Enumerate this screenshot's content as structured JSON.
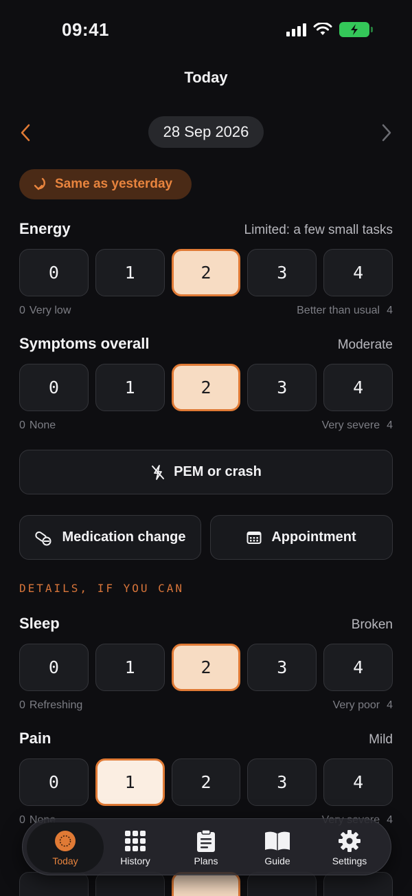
{
  "status": {
    "time": "09:41"
  },
  "header": {
    "title": "Today"
  },
  "date": {
    "label": "28 Sep 2026"
  },
  "same_as_yesterday": "Same as yesterday",
  "colors": {
    "accent": "#e07a35",
    "selected_fill": "#f7dcc3",
    "background": "#0e0e11"
  },
  "scales": [
    {
      "title": "Energy",
      "value": "Limited: a few small tasks",
      "options": [
        "0",
        "1",
        "2",
        "3",
        "4"
      ],
      "selected": "2",
      "low_num": "0",
      "low_label": "Very low",
      "high_label": "Better than usual",
      "high_num": "4"
    },
    {
      "title": "Symptoms overall",
      "value": "Moderate",
      "options": [
        "0",
        "1",
        "2",
        "3",
        "4"
      ],
      "selected": "2",
      "low_num": "0",
      "low_label": "None",
      "high_label": "Very severe",
      "high_num": "4"
    },
    {
      "title": "Sleep",
      "value": "Broken",
      "options": [
        "0",
        "1",
        "2",
        "3",
        "4"
      ],
      "selected": "2",
      "low_num": "0",
      "low_label": "Refreshing",
      "high_label": "Very poor",
      "high_num": "4"
    },
    {
      "title": "Pain",
      "value": "Mild",
      "options": [
        "0",
        "1",
        "2",
        "3",
        "4"
      ],
      "selected": "1",
      "low_num": "0",
      "low_label": "None",
      "high_label": "Very severe",
      "high_num": "4"
    }
  ],
  "events": {
    "pem": {
      "label": "PEM or crash",
      "icon": "crossed-bolt-icon"
    },
    "medication": {
      "label": "Medication change",
      "icon": "pill-icon"
    },
    "appointment": {
      "label": "Appointment",
      "icon": "calendar-icon"
    }
  },
  "details_label": "DETAILS, IF YOU CAN",
  "tabs": [
    {
      "label": "Today",
      "icon": "sun-icon",
      "active": true
    },
    {
      "label": "History",
      "icon": "grid-icon",
      "active": false
    },
    {
      "label": "Plans",
      "icon": "clipboard-icon",
      "active": false
    },
    {
      "label": "Guide",
      "icon": "book-icon",
      "active": false
    },
    {
      "label": "Settings",
      "icon": "gear-icon",
      "active": false
    }
  ]
}
